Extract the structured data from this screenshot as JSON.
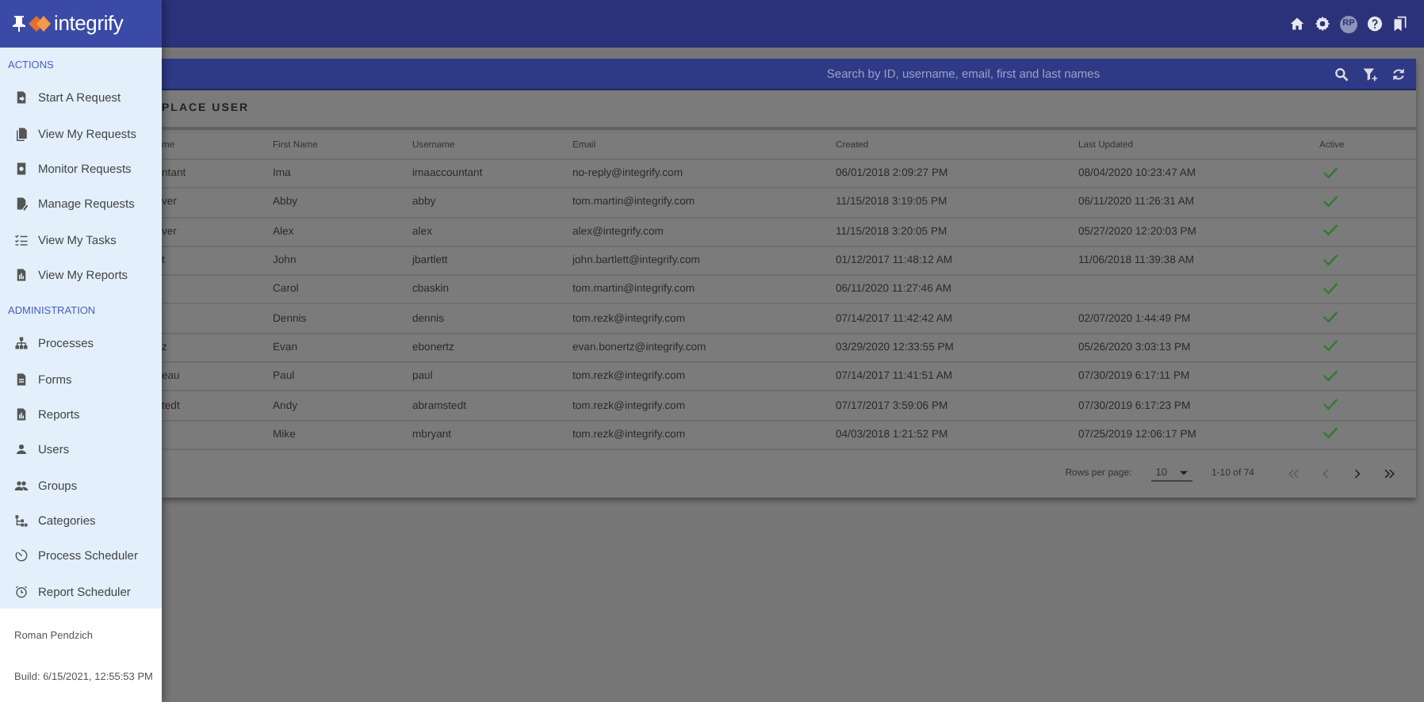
{
  "drawer": {
    "logo": "integrify",
    "sections": [
      {
        "title": "ACTIONS",
        "items": [
          "Start A Request",
          "View My Requests",
          "Monitor Requests",
          "Manage Requests",
          "View My Tasks",
          "View My Reports"
        ]
      },
      {
        "title": "ADMINISTRATION",
        "items": [
          "Processes",
          "Forms",
          "Reports",
          "Users",
          "Groups",
          "Categories",
          "Process Scheduler",
          "Report Scheduler"
        ]
      }
    ],
    "user": "Roman Pendzich",
    "build": "Build: 6/15/2021, 12:55:53 PM"
  },
  "top_bar": {
    "avatar": "RP"
  },
  "search": {
    "placeholder": "Search by ID, username, email, first and last names"
  },
  "action_bar": {
    "button": "PLACE USER"
  },
  "table": {
    "columns": [
      "me",
      "First Name",
      "Username",
      "Email",
      "Created",
      "Last Updated",
      "Active"
    ],
    "rows": [
      {
        "column_1": "ntant",
        "first_name": "Ima",
        "username": "imaaccountant",
        "email": "no-reply@integrify.com",
        "created": "06/01/2018 2:09:27 PM",
        "last_updated": "08/04/2020 10:23:47 AM",
        "active": true
      },
      {
        "column_1": "ver",
        "first_name": "Abby",
        "username": "abby",
        "email": "tom.martin@integrify.com",
        "created": "11/15/2018 3:19:05 PM",
        "last_updated": "06/11/2020 11:26:31 AM",
        "active": true
      },
      {
        "column_1": "ver",
        "first_name": "Alex",
        "username": "alex",
        "email": "alex@integrify.com",
        "created": "11/15/2018 3:20:05 PM",
        "last_updated": "05/27/2020 12:20:03 PM",
        "active": true
      },
      {
        "column_1": "t",
        "first_name": "John",
        "username": "jbartlett",
        "email": "john.bartlett@integrify.com",
        "created": "01/12/2017 11:48:12 AM",
        "last_updated": "11/06/2018 11:39:38 AM",
        "active": true
      },
      {
        "first_name": "Carol",
        "username": "cbaskin",
        "email": "tom.martin@integrify.com",
        "created": "06/11/2020 11:27:46 AM",
        "active": true
      },
      {
        "first_name": "Dennis",
        "username": "dennis",
        "email": "tom.rezk@integrify.com",
        "created": "07/14/2017 11:42:42 AM",
        "last_updated": "02/07/2020 1:44:49 PM",
        "active": true
      },
      {
        "column_1": "z",
        "first_name": "Evan",
        "username": "ebonertz",
        "email": "evan.bonertz@integrify.com",
        "created": "03/29/2020 12:33:55 PM",
        "last_updated": "05/26/2020 3:03:13 PM",
        "active": true
      },
      {
        "column_1": "eau",
        "first_name": "Paul",
        "username": "paul",
        "email": "tom.rezk@integrify.com",
        "created": "07/14/2017 11:41:51 AM",
        "last_updated": "07/30/2019 6:17:11 PM",
        "active": true
      },
      {
        "column_1": "tedt",
        "first_name": "Andy",
        "username": "abramstedt",
        "email": "tom.rezk@integrify.com",
        "created": "07/17/2017 3:59:06 PM",
        "last_updated": "07/30/2019 6:17:23 PM",
        "active": true
      },
      {
        "first_name": "Mike",
        "username": "mbryant",
        "email": "tom.rezk@integrify.com",
        "created": "04/03/2018 1:21:52 PM",
        "last_updated": "07/25/2019 12:06:17 PM",
        "active": true
      }
    ]
  },
  "pagination": {
    "rows_per_page_label": "Rows per page:",
    "rows_per_page": "10",
    "range": "1-10 of 74",
    "buttons": [
      {
        "kind": "first",
        "disabled": true
      },
      {
        "kind": "prev",
        "disabled": true
      },
      {
        "kind": "next",
        "disabled": false
      },
      {
        "kind": "last",
        "disabled": false
      }
    ]
  }
}
